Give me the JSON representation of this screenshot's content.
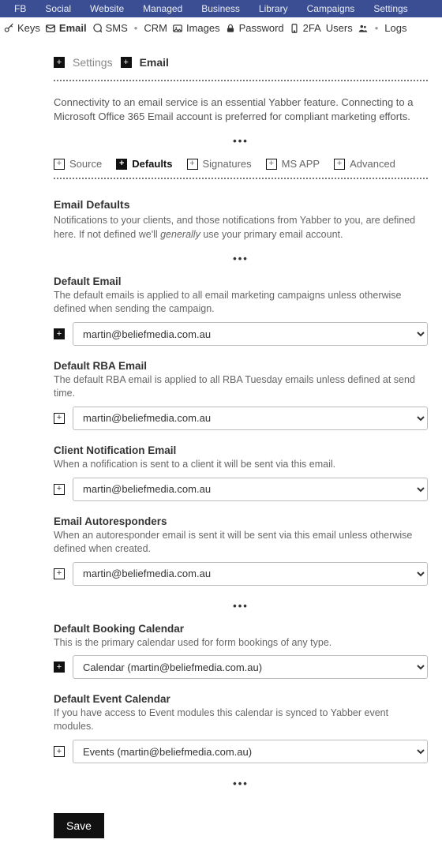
{
  "topnav": [
    "FB",
    "Social",
    "Website",
    "Managed",
    "Business",
    "Library",
    "Campaigns",
    "Settings"
  ],
  "subnav": [
    {
      "icon": "key",
      "label": "Keys"
    },
    {
      "icon": "mail",
      "label": "Email",
      "strong": true
    },
    {
      "icon": "chat",
      "label": "SMS"
    },
    {
      "sep": true
    },
    {
      "label": "CRM"
    },
    {
      "icon": "image",
      "label": "Images"
    },
    {
      "icon": "lock",
      "label": "Password"
    },
    {
      "icon": "phone",
      "label": "2FA"
    },
    {
      "label": "Users"
    },
    {
      "icon": "users",
      "label": ""
    },
    {
      "sep": true
    },
    {
      "label": "Logs"
    }
  ],
  "crumb": {
    "a": "Settings",
    "b": "Email"
  },
  "intro": "Connectivity to an email service is an essential Yabber feature. Connecting to a Microsoft Office 365 Email account is preferred for compliant marketing efforts.",
  "tabs": [
    {
      "label": "Source",
      "active": false
    },
    {
      "label": "Defaults",
      "active": true
    },
    {
      "label": "Signatures",
      "active": false
    },
    {
      "label": "MS APP",
      "active": false
    },
    {
      "label": "Advanced",
      "active": false
    }
  ],
  "section": {
    "title": "Email Defaults",
    "desc_a": "Notifications to your clients, and those notifications from Yabber to you, are defined here. If not defined we'll ",
    "desc_em": "generally",
    "desc_b": " use your primary email account."
  },
  "blurred": "martin",
  "domain": "@beliefmedia.com.au",
  "fields": {
    "default_email": {
      "label": "Default Email",
      "desc": "The default emails is applied to all email marketing campaigns unless otherwise defined when sending the campaign.",
      "filled": true
    },
    "default_rba": {
      "label": "Default RBA Email",
      "desc": "The default RBA email is applied to all RBA Tuesday emails unless defined at send time.",
      "filled": false
    },
    "client_notif": {
      "label": "Client Notification Email",
      "desc": "When a nofification is sent to a client it will be sent via this email.",
      "filled": false
    },
    "autoresp": {
      "label": "Email Autoresponders",
      "desc": "When an autoresponder email is sent it will be sent via this email unless otherwise defined when created.",
      "filled": false
    },
    "booking_cal": {
      "label": "Default Booking Calendar",
      "desc": "This is the primary calendar used for form bookings of any type.",
      "filled": true,
      "prefix": "Calendar (",
      "suffix": ")"
    },
    "event_cal": {
      "label": "Default Event Calendar",
      "desc": "If you have access to Event modules this calendar is synced to Yabber event modules.",
      "filled": false,
      "prefix": "Events (",
      "suffix": ")"
    }
  },
  "save": "Save"
}
